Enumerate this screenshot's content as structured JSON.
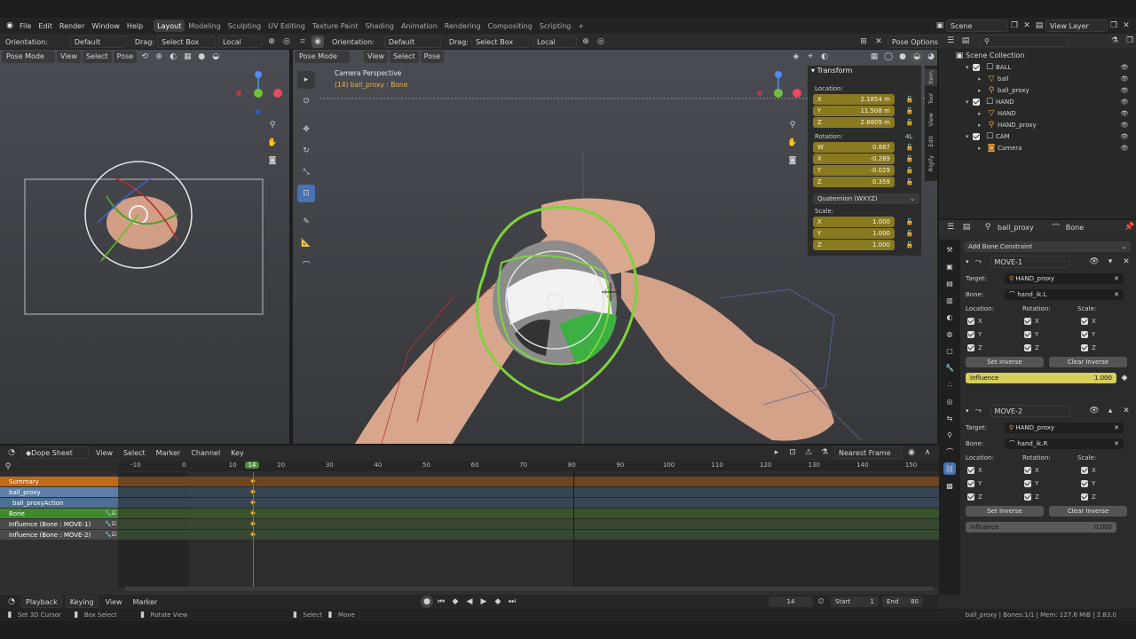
{
  "menu": {
    "file": "File",
    "edit": "Edit",
    "render": "Render",
    "window": "Window",
    "help": "Help"
  },
  "workspaces": [
    "Layout",
    "Modeling",
    "Sculpting",
    "UV Editing",
    "Texture Paint",
    "Shading",
    "Animation",
    "Rendering",
    "Compositing",
    "Scripting"
  ],
  "add_workspace": "+",
  "scene": "Scene",
  "view_layer": "View Layer",
  "tool_options": {
    "orientation_label": "Orientation:",
    "orientation_value": "Default",
    "drag_label": "Drag:",
    "drag_value": "Select Box",
    "local": "Local",
    "pose_options": "Pose Options"
  },
  "left_view": {
    "mode": "Pose Mode",
    "view": "View",
    "select": "Select",
    "pose": "Pose"
  },
  "main_view": {
    "mode": "Pose Mode",
    "view": "View",
    "select": "Select",
    "pose": "Pose",
    "camera_label": "Camera Perspective",
    "object_label": "(14) ball_proxy : Bone"
  },
  "n_panel": {
    "title": "Transform",
    "location_label": "Location:",
    "location": [
      {
        "axis": "X",
        "value": "2.1854 m"
      },
      {
        "axis": "Y",
        "value": "11.508 m"
      },
      {
        "axis": "Z",
        "value": "2.8809 m"
      }
    ],
    "rotation_label": "Rotation:",
    "rotation_mode_short": "4L",
    "rotation": [
      {
        "axis": "W",
        "value": "0.887"
      },
      {
        "axis": "X",
        "value": "-0.289"
      },
      {
        "axis": "Y",
        "value": "-0.029"
      },
      {
        "axis": "Z",
        "value": "0.359"
      }
    ],
    "rotation_mode": "Quaternion (WXYZ)",
    "scale_label": "Scale:",
    "scale": [
      {
        "axis": "X",
        "value": "1.000"
      },
      {
        "axis": "Y",
        "value": "1.000"
      },
      {
        "axis": "Z",
        "value": "1.000"
      }
    ],
    "tabs": [
      "Item",
      "Tool",
      "View",
      "Edit",
      "Rigify"
    ]
  },
  "outliner": {
    "title": "Scene Collection",
    "items": [
      {
        "label": "BALL",
        "depth": 1,
        "type": "collection"
      },
      {
        "label": "ball",
        "depth": 2,
        "type": "mesh"
      },
      {
        "label": "ball_proxy",
        "depth": 2,
        "type": "armature"
      },
      {
        "label": "HAND",
        "depth": 1,
        "type": "collection"
      },
      {
        "label": "HAND",
        "depth": 2,
        "type": "mesh"
      },
      {
        "label": "HAND_proxy",
        "depth": 2,
        "type": "armature"
      },
      {
        "label": "CAM",
        "depth": 1,
        "type": "collection"
      },
      {
        "label": "Camera",
        "depth": 2,
        "type": "camera"
      }
    ]
  },
  "properties": {
    "breadcrumb_object": "ball_proxy",
    "breadcrumb_bone": "Bone",
    "add_constraint": "Add Bone Constraint",
    "constraints": [
      {
        "name": "MOVE-1",
        "target_label": "Target:",
        "target": "HAND_proxy",
        "bone_label": "Bone:",
        "bone": "hand_ik.L",
        "location_label": "Location:",
        "rotation_label": "Rotation:",
        "scale_label": "Scale:",
        "x": "X",
        "y": "Y",
        "z": "Z",
        "set_inverse": "Set Inverse",
        "clear_inverse": "Clear Inverse",
        "influence_label": "Influence",
        "influence": "1.000",
        "influence_frac": 1.0
      },
      {
        "name": "MOVE-2",
        "target_label": "Target:",
        "target": "HAND_proxy",
        "bone_label": "Bone:",
        "bone": "hand_ik.R",
        "location_label": "Location:",
        "rotation_label": "Rotation:",
        "scale_label": "Scale:",
        "x": "X",
        "y": "Y",
        "z": "Z",
        "set_inverse": "Set Inverse",
        "clear_inverse": "Clear Inverse",
        "influence_label": "Influence",
        "influence": "0.000",
        "influence_frac": 0.0
      }
    ]
  },
  "dopesheet": {
    "mode": "Dope Sheet",
    "view": "View",
    "select": "Select",
    "marker": "Marker",
    "channel": "Channel",
    "key": "Key",
    "snapping": "Nearest Frame",
    "ruler": [
      "-10",
      "0",
      "10",
      "14",
      "20",
      "30",
      "40",
      "50",
      "60",
      "70",
      "80",
      "90",
      "100",
      "110",
      "120",
      "130",
      "140",
      "150"
    ],
    "current_frame": "14",
    "channels": [
      {
        "label": "Summary",
        "color": "#c06a18"
      },
      {
        "label": "ball_proxy",
        "color": "#5d7fa8"
      },
      {
        "label": "ball_proxyAction",
        "color": "#4e6f93"
      },
      {
        "label": "Bone",
        "color": "#3f8a2b"
      },
      {
        "label": "Influence (Bone : MOVE-1)",
        "color": "#4a4a4a"
      },
      {
        "label": "Influence (Bone : MOVE-2)",
        "color": "#4a4a4a"
      }
    ]
  },
  "timeline": {
    "playback": "Playback",
    "keying": "Keying",
    "view": "View",
    "marker": "Marker",
    "frame": "14",
    "start_label": "Start",
    "start": "1",
    "end_label": "End",
    "end": "80"
  },
  "status": {
    "set_cursor": "Set 3D Cursor",
    "box_select": "Box Select",
    "rotate_view": "Rotate View",
    "select": "Select",
    "move": "Move",
    "info": "ball_proxy | Bones:1/1 | Mem: 127.6 MiB | 2.83.0"
  },
  "colors": {
    "accent": "#4772b3",
    "bone_green": "#7cd43c",
    "key_yellow": "#e8b43c",
    "field_yellow": "#8a7a1f"
  }
}
